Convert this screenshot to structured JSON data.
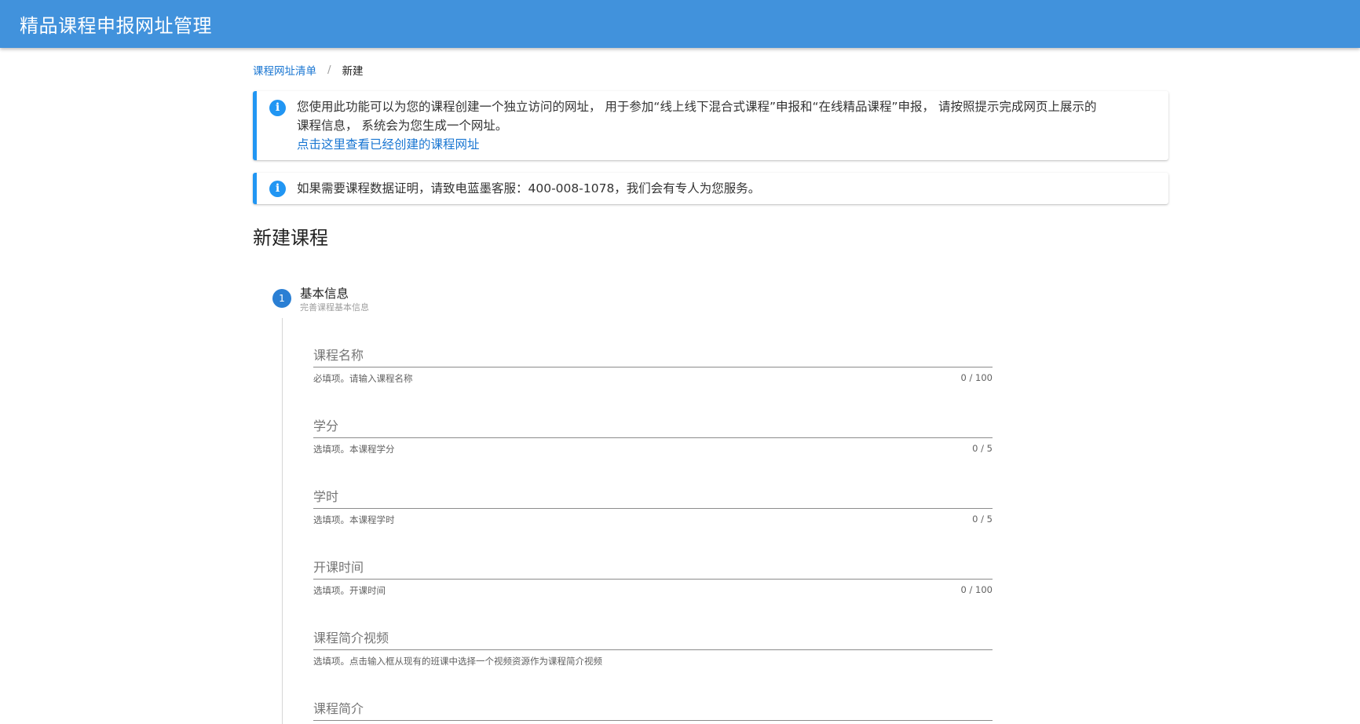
{
  "app": {
    "title": "精品课程申报网址管理"
  },
  "breadcrumb": {
    "parent": "课程网址清单",
    "separator": "/",
    "current": "新建"
  },
  "alerts": {
    "first": {
      "line1": "您使用此功能可以为您的课程创建一个独立访问的网址， 用于参加“线上线下混合式课程”申报和“在线精品课程”申报， 请按照提示完成网页上展示的",
      "line2": "课程信息， 系统会为您生成一个网址。",
      "link": "点击这里查看已经创建的课程网址"
    },
    "second": {
      "text": "如果需要课程数据证明，请致电蓝墨客服：400-008-1078，我们会有专人为您服务。"
    }
  },
  "page": {
    "title": "新建课程"
  },
  "step": {
    "number": "1",
    "title": "基本信息",
    "subtitle": "完善课程基本信息"
  },
  "fields": [
    {
      "label": "课程名称",
      "hint": "必填项。请输入课程名称",
      "counter": "0 / 100"
    },
    {
      "label": "学分",
      "hint": "选填项。本课程学分",
      "counter": "0 / 5"
    },
    {
      "label": "学时",
      "hint": "选填项。本课程学时",
      "counter": "0 / 5"
    },
    {
      "label": "开课时间",
      "hint": "选填项。开课时间",
      "counter": "0 / 100"
    },
    {
      "label": "课程简介视频",
      "hint": "选填项。点击输入框从现有的班课中选择一个视频资源作为课程简介视频",
      "counter": ""
    },
    {
      "label": "课程简介"
    }
  ],
  "colors": {
    "appbar": "#4192dc",
    "accent": "#2196f3",
    "step": "#2a7fd4"
  },
  "icons": {
    "alert": "info-icon"
  }
}
